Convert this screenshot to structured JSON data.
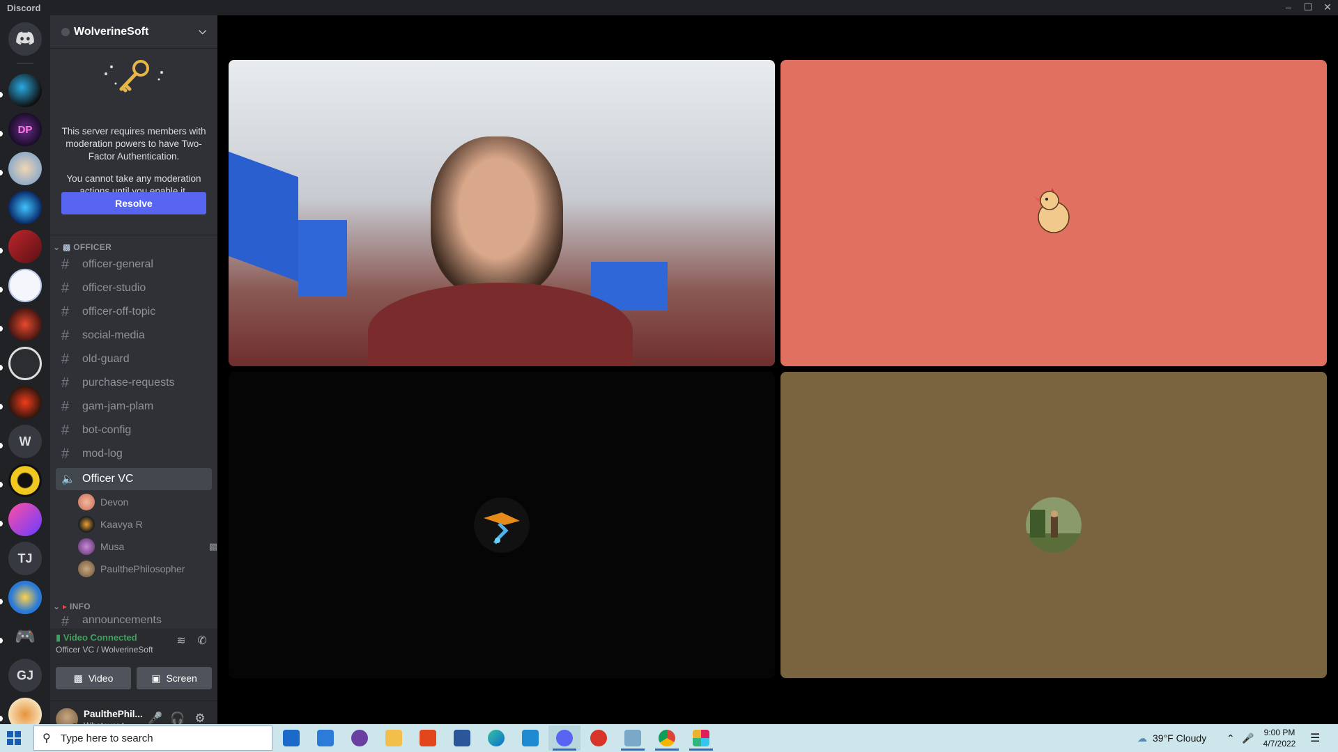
{
  "window": {
    "title": "Discord"
  },
  "guilds": {
    "letters": [
      "W",
      "TJ",
      "GJ"
    ]
  },
  "server": {
    "name": "WolverineSoft",
    "notice_line1": "This server requires members with moderation powers to have Two-Factor Authentication.",
    "notice_line2": "You cannot take any moderation actions until you enable it.",
    "resolve_label": "Resolve"
  },
  "categories": {
    "officer": "OFFICER",
    "info": "INFO"
  },
  "channels": [
    "officer-general",
    "officer-studio",
    "officer-off-topic",
    "social-media",
    "old-guard",
    "purchase-requests",
    "gam-jam-plam",
    "bot-config",
    "mod-log"
  ],
  "voice": {
    "channel": "Officer VC",
    "users": [
      "Devon",
      "Kaavya R",
      "Musa",
      "PaulthePhilosopher"
    ]
  },
  "info_channels": [
    "announcements"
  ],
  "rtc": {
    "status": "Video Connected",
    "location": "Officer VC / WolverineSoft",
    "video_label": "Video",
    "screen_label": "Screen"
  },
  "user": {
    "name": "PaulthePhil...",
    "status": "Whatever t..."
  },
  "taskbar": {
    "search_placeholder": "Type here to search",
    "weather": "39°F  Cloudy",
    "time": "9:00 PM",
    "date": "4/7/2022"
  },
  "colors": {
    "blurple": "#5865f2",
    "green": "#3ba55d",
    "tile_coral": "#e07060",
    "tile_olive": "#7a6440"
  }
}
